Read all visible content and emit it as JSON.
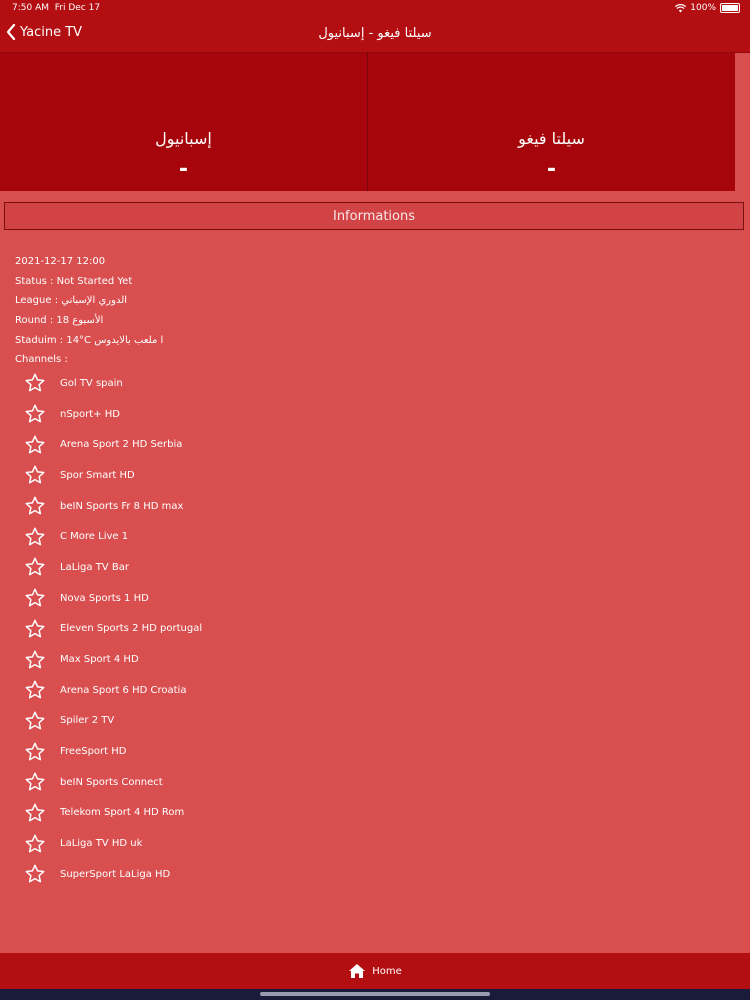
{
  "status_bar": {
    "time": "7:50 AM",
    "date": "Fri Dec 17",
    "battery": "100%",
    "icons": [
      "wifi-icon",
      "battery-icon"
    ]
  },
  "nav": {
    "back_label": "Yacine TV",
    "title": "سيلتا فيغو - إسبانيول"
  },
  "match": {
    "home_team": "سيلتا فيغو",
    "home_score": "-",
    "away_team": "إسبانيول",
    "away_score": "-"
  },
  "info_header": "Informations",
  "details": {
    "datetime": "2021-12-17 12:00",
    "status": "Status : Not Started Yet",
    "league": "League : الدوري الإسباني",
    "round": "Round : الأسبوع 18",
    "stadium": "Staduim : 14°C ا ملعب بالايدوس",
    "channels_label": "Channels :"
  },
  "channels": [
    "Gol TV spain",
    "nSport+ HD",
    "Arena Sport 2 HD Serbia",
    "Spor Smart HD",
    "beIN Sports Fr 8 HD max",
    "C More Live 1",
    "LaLiga TV Bar",
    "Nova Sports 1 HD",
    "Eleven Sports 2 HD portugal",
    "Max Sport 4 HD",
    "Arena Sport 6 HD Croatia",
    "Spiler 2 TV",
    "FreeSport HD",
    "beIN Sports Connect",
    "Telekom Sport 4 HD Rom",
    "LaLiga TV HD uk",
    "SuperSport LaLiga HD"
  ],
  "tabbar": {
    "home_label": "Home",
    "icon": "home-icon"
  },
  "colors": {
    "header_red": "#b30e12",
    "team_panel": "#a5050b",
    "background": "#d94f50"
  }
}
